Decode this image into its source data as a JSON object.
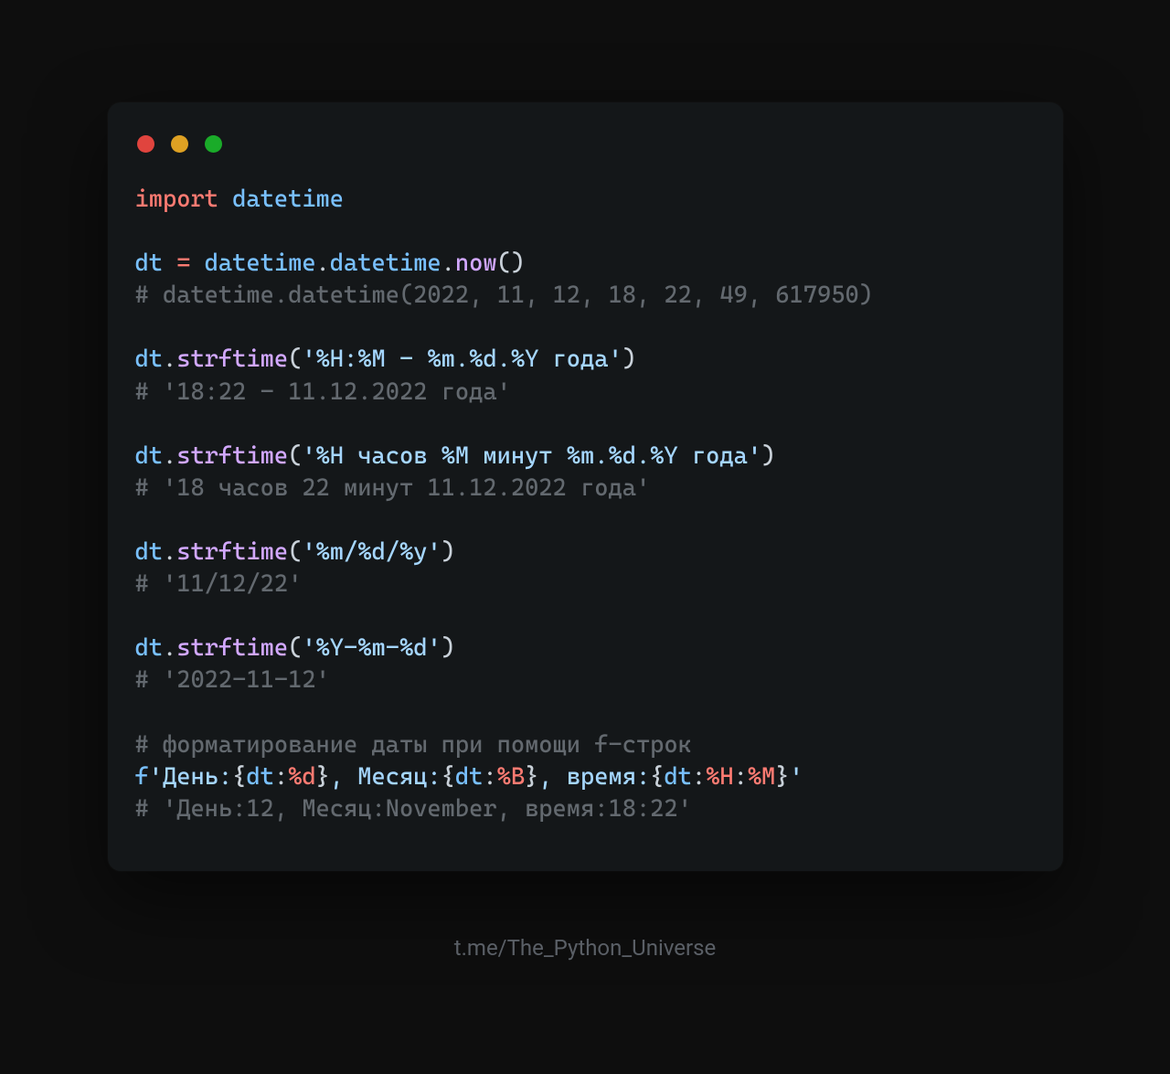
{
  "footer": "t.me/The_Python_Universe",
  "code": {
    "lines": [
      {
        "type": "tokens",
        "tokens": [
          {
            "cls": "kw",
            "t": "import"
          },
          {
            "cls": "punc",
            "t": " "
          },
          {
            "cls": "mod",
            "t": "datetime"
          }
        ]
      },
      {
        "type": "blank"
      },
      {
        "type": "tokens",
        "tokens": [
          {
            "cls": "var",
            "t": "dt"
          },
          {
            "cls": "punc",
            "t": " "
          },
          {
            "cls": "op",
            "t": "="
          },
          {
            "cls": "punc",
            "t": " "
          },
          {
            "cls": "mod",
            "t": "datetime"
          },
          {
            "cls": "punc",
            "t": "."
          },
          {
            "cls": "mod",
            "t": "datetime"
          },
          {
            "cls": "punc",
            "t": "."
          },
          {
            "cls": "call",
            "t": "now"
          },
          {
            "cls": "punc",
            "t": "()"
          }
        ]
      },
      {
        "type": "comment",
        "text": "# datetime.datetime(2022, 11, 12, 18, 22, 49, 617950)"
      },
      {
        "type": "blank"
      },
      {
        "type": "tokens",
        "tokens": [
          {
            "cls": "var",
            "t": "dt"
          },
          {
            "cls": "punc",
            "t": "."
          },
          {
            "cls": "call",
            "t": "strftime"
          },
          {
            "cls": "punc",
            "t": "("
          },
          {
            "cls": "str",
            "t": "'%H:%M - %m.%d.%Y года'"
          },
          {
            "cls": "punc",
            "t": ")"
          }
        ]
      },
      {
        "type": "comment",
        "text": "# '18:22 - 11.12.2022 года'"
      },
      {
        "type": "blank"
      },
      {
        "type": "tokens",
        "tokens": [
          {
            "cls": "var",
            "t": "dt"
          },
          {
            "cls": "punc",
            "t": "."
          },
          {
            "cls": "call",
            "t": "strftime"
          },
          {
            "cls": "punc",
            "t": "("
          },
          {
            "cls": "str",
            "t": "'%H часов %M минут %m.%d.%Y года'"
          },
          {
            "cls": "punc",
            "t": ")"
          }
        ]
      },
      {
        "type": "comment",
        "text": "# '18 часов 22 минут 11.12.2022 года'"
      },
      {
        "type": "blank"
      },
      {
        "type": "tokens",
        "tokens": [
          {
            "cls": "var",
            "t": "dt"
          },
          {
            "cls": "punc",
            "t": "."
          },
          {
            "cls": "call",
            "t": "strftime"
          },
          {
            "cls": "punc",
            "t": "("
          },
          {
            "cls": "str",
            "t": "'%m/%d/%y'"
          },
          {
            "cls": "punc",
            "t": ")"
          }
        ]
      },
      {
        "type": "comment",
        "text": "# '11/12/22'"
      },
      {
        "type": "blank"
      },
      {
        "type": "tokens",
        "tokens": [
          {
            "cls": "var",
            "t": "dt"
          },
          {
            "cls": "punc",
            "t": "."
          },
          {
            "cls": "call",
            "t": "strftime"
          },
          {
            "cls": "punc",
            "t": "("
          },
          {
            "cls": "str",
            "t": "'%Y-%m-%d'"
          },
          {
            "cls": "punc",
            "t": ")"
          }
        ]
      },
      {
        "type": "comment",
        "text": "# '2022-11-12'"
      },
      {
        "type": "blank"
      },
      {
        "type": "comment",
        "text": "# форматирование даты при помощи f-строк"
      },
      {
        "type": "tokens",
        "tokens": [
          {
            "cls": "fpfx",
            "t": "f"
          },
          {
            "cls": "str",
            "t": "'День:"
          },
          {
            "cls": "fbrace",
            "t": "{"
          },
          {
            "cls": "var",
            "t": "dt"
          },
          {
            "cls": "punc",
            "t": ":"
          },
          {
            "cls": "fmt-spec",
            "t": "%d"
          },
          {
            "cls": "fbrace",
            "t": "}"
          },
          {
            "cls": "str",
            "t": ", Месяц:"
          },
          {
            "cls": "fbrace",
            "t": "{"
          },
          {
            "cls": "var",
            "t": "dt"
          },
          {
            "cls": "punc",
            "t": ":"
          },
          {
            "cls": "fmt-spec",
            "t": "%B"
          },
          {
            "cls": "fbrace",
            "t": "}"
          },
          {
            "cls": "str",
            "t": ", время:"
          },
          {
            "cls": "fbrace",
            "t": "{"
          },
          {
            "cls": "var",
            "t": "dt"
          },
          {
            "cls": "punc",
            "t": ":"
          },
          {
            "cls": "fmt-spec",
            "t": "%H"
          },
          {
            "cls": "punc",
            "t": ":"
          },
          {
            "cls": "fmt-spec",
            "t": "%M"
          },
          {
            "cls": "fbrace",
            "t": "}"
          },
          {
            "cls": "str",
            "t": "'"
          }
        ]
      },
      {
        "type": "comment",
        "text": "# 'День:12, Месяц:November, время:18:22'"
      }
    ]
  }
}
